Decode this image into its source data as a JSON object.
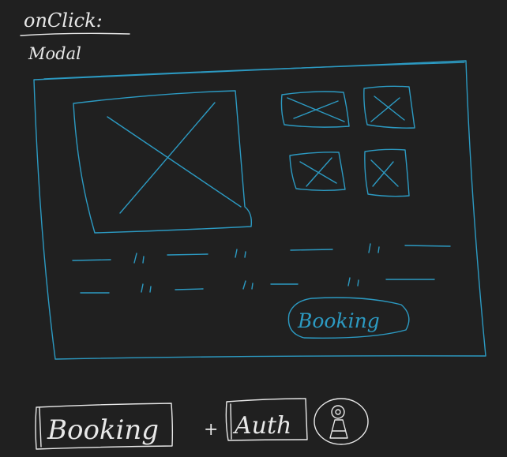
{
  "header": {
    "line1": "onClick:",
    "line2": "Modal"
  },
  "modal": {
    "button_label": "Booking",
    "text_placeholder_rows": [
      [
        "—",
        "—",
        "—",
        "—"
      ],
      [
        "—",
        "—",
        "—",
        "—"
      ]
    ]
  },
  "footer": {
    "component1": "Booking",
    "plus": "+",
    "component2": "Auth",
    "icon": "user-icon"
  },
  "colors": {
    "background": "#202020",
    "sketch_blue": "#2c9ac2",
    "sketch_white": "#e8e8e8"
  }
}
